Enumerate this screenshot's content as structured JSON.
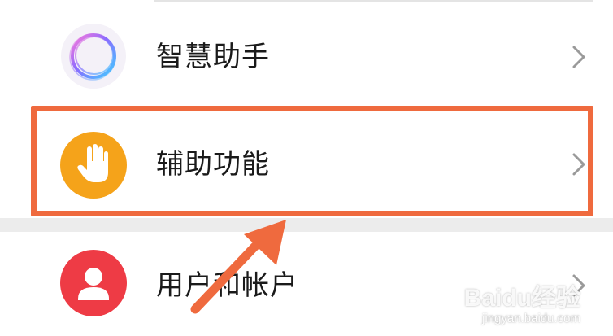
{
  "settings_list": {
    "items": [
      {
        "label": "智慧助手",
        "icon": "assistant-ring-icon"
      },
      {
        "label": "辅助功能",
        "icon": "hand-icon",
        "highlighted": true
      },
      {
        "label": "用户和帐户",
        "icon": "user-icon"
      }
    ]
  },
  "colors": {
    "highlight": "#ef6a3e",
    "accessibility_icon_bg": "#f5a31a",
    "user_icon_bg": "#ee3b45"
  },
  "watermark": {
    "brand": "Baidu经验",
    "url": "jingyan.baidu.com"
  }
}
